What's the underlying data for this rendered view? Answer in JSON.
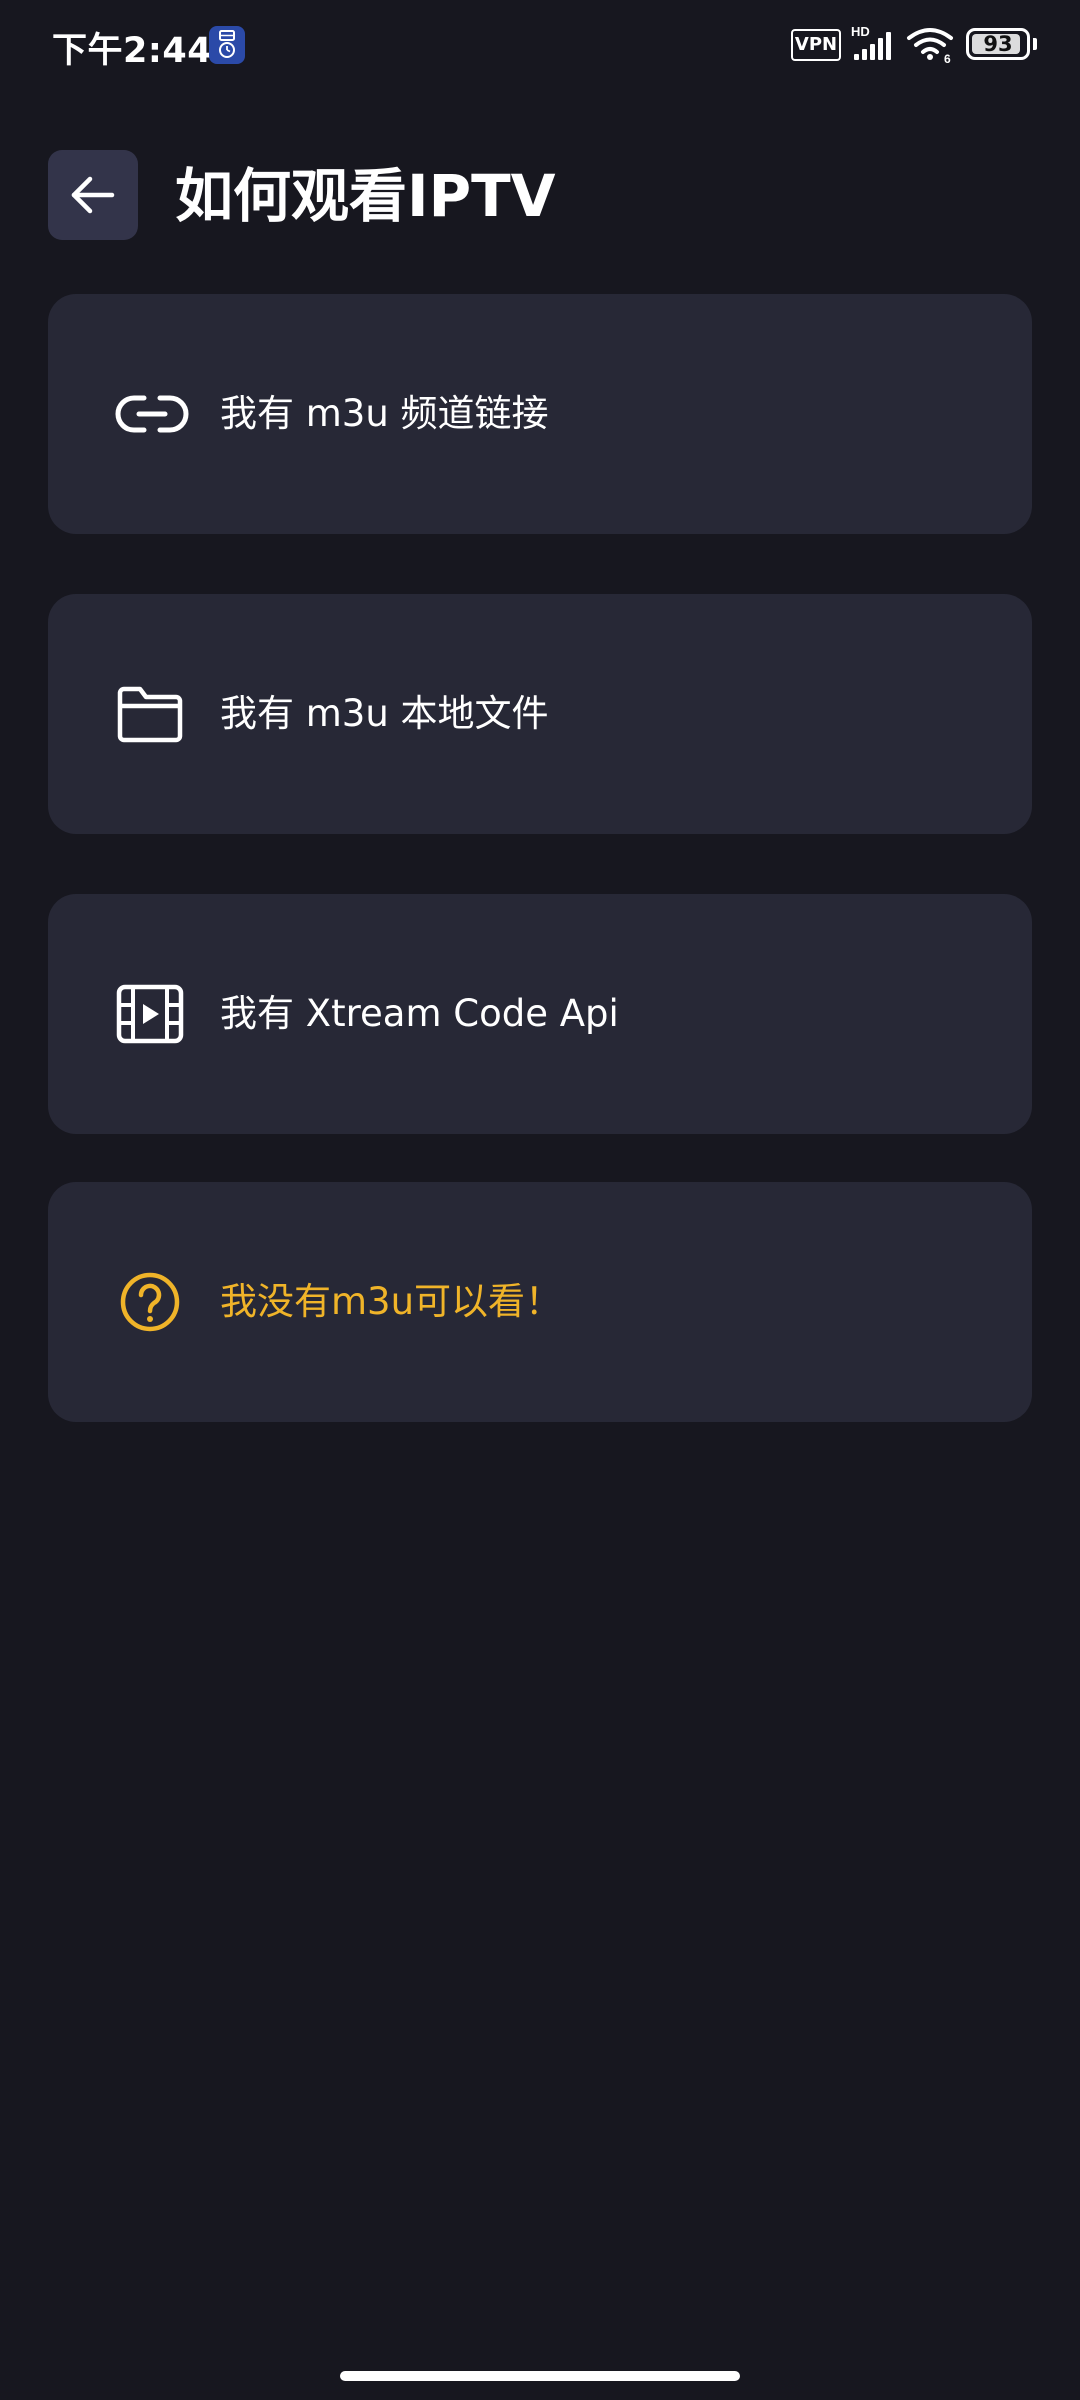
{
  "status_bar": {
    "time": "下午2:44",
    "vpn_label": "VPN",
    "network_label": "HD",
    "wifi_generation": "6",
    "battery_level": "93",
    "battery_fraction": 0.93,
    "notification_icon": "app-notification-icon"
  },
  "header": {
    "back_icon": "arrow-left-icon",
    "title": "如何观看IPTV"
  },
  "options": [
    {
      "icon": "link-icon",
      "label": "我有 m3u 频道链接",
      "highlight": false
    },
    {
      "icon": "folder-icon",
      "label": "我有 m3u 本地文件",
      "highlight": false
    },
    {
      "icon": "film-icon",
      "label": "我有 Xtream Code Api",
      "highlight": false
    },
    {
      "icon": "question-circle-icon",
      "label": "我没有m3u可以看！",
      "highlight": true
    }
  ],
  "colors": {
    "background": "#17171f",
    "card": "#272836",
    "back_button": "#33344a",
    "text": "#ffffff",
    "accent": "#f0b429"
  }
}
